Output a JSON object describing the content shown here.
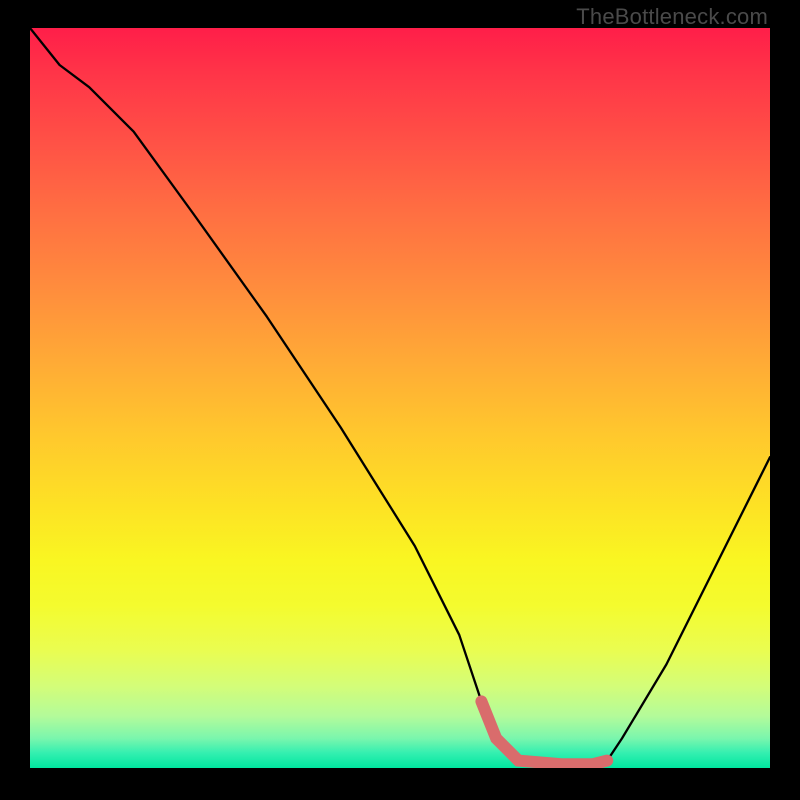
{
  "watermark": "TheBottleneck.com",
  "colors": {
    "curve_stroke": "#000000",
    "highlight_stroke": "#d96c6c",
    "background": "#000000"
  },
  "chart_data": {
    "type": "line",
    "title": "",
    "xlabel": "",
    "ylabel": "",
    "xlim": [
      0,
      100
    ],
    "ylim": [
      0,
      100
    ],
    "series": [
      {
        "name": "bottleneck_curve",
        "x": [
          0,
          4,
          8,
          14,
          22,
          32,
          42,
          52,
          58,
          61,
          63,
          66,
          72,
          76,
          78,
          80,
          86,
          92,
          98,
          100
        ],
        "y": [
          100,
          95,
          92,
          86,
          75,
          61,
          46,
          30,
          18,
          9,
          4,
          1,
          0.5,
          0.5,
          1,
          4,
          14,
          26,
          38,
          42
        ]
      }
    ],
    "highlight_segment": {
      "name": "optimal_flat_region",
      "x": [
        61,
        63,
        66,
        72,
        76,
        78
      ],
      "y": [
        9,
        4,
        1,
        0.5,
        0.5,
        1
      ]
    },
    "background_gradient": {
      "direction": "vertical_top_to_bottom",
      "stops": [
        {
          "pos": 0.0,
          "color": "#ff1e49"
        },
        {
          "pos": 0.25,
          "color": "#ff6f42"
        },
        {
          "pos": 0.55,
          "color": "#ffc82d"
        },
        {
          "pos": 0.78,
          "color": "#f4fb2e"
        },
        {
          "pos": 0.93,
          "color": "#b3fb9a"
        },
        {
          "pos": 1.0,
          "color": "#00e69f"
        }
      ]
    }
  }
}
